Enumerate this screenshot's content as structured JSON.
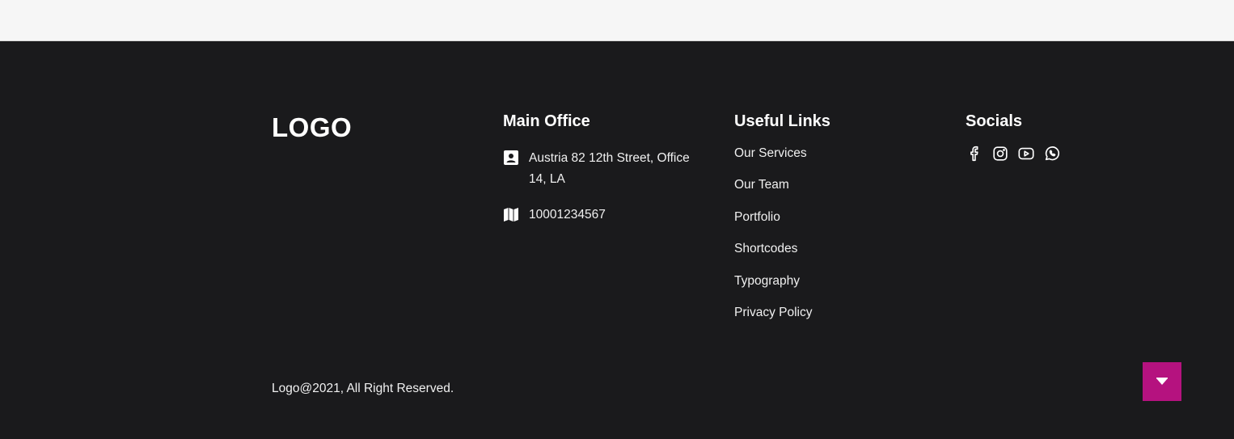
{
  "colors": {
    "footer_background": "#1a1a1c",
    "top_strip": "#f6f6f6",
    "text": "#ffffff",
    "accent": "#b5127f"
  },
  "brand": {
    "logo_text": "LOGO"
  },
  "main_office": {
    "heading": "Main Office",
    "address": {
      "icon": "address-card-icon",
      "text": "Austria 82 12th Street, Office 14, LA"
    },
    "phone": {
      "icon": "map-icon",
      "text": "10001234567"
    }
  },
  "useful_links": {
    "heading": "Useful Links",
    "items": [
      {
        "label": "Our Services"
      },
      {
        "label": "Our Team"
      },
      {
        "label": "Portfolio"
      },
      {
        "label": "Shortcodes"
      },
      {
        "label": "Typography"
      },
      {
        "label": "Privacy Policy"
      }
    ]
  },
  "socials": {
    "heading": "Socials",
    "icons": [
      "facebook-icon",
      "instagram-icon",
      "youtube-icon",
      "whatsapp-icon"
    ]
  },
  "copyright": "Logo@2021, All Right Reserved.",
  "scroll_button": {
    "icon": "caret-down-icon"
  }
}
